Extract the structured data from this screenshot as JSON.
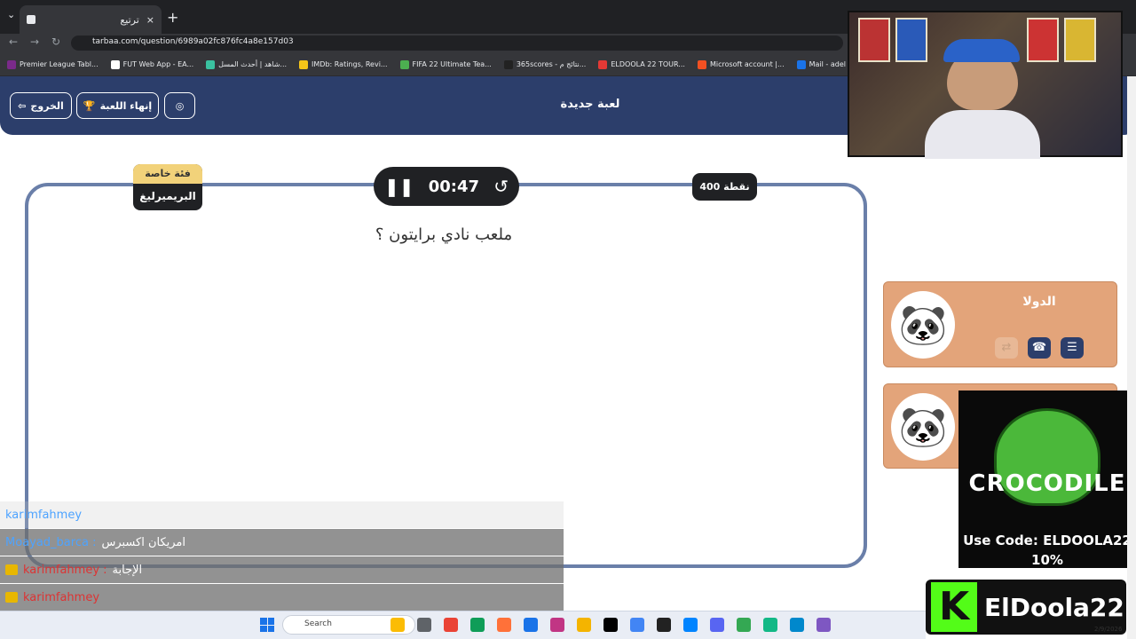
{
  "browser": {
    "tab_title": "ترتيع",
    "new_tab": "+",
    "url": "tarbaa.com/question/6989a02fc876fc4a8e157d03",
    "bookmarks": [
      {
        "label": "Premier League Tabl...",
        "color": "#7a2a8a"
      },
      {
        "label": "FUT Web App - EA...",
        "color": "#ffffff"
      },
      {
        "label": "شاهد | أحدث المسل...",
        "color": "#3ac1a0"
      },
      {
        "label": "IMDb: Ratings, Revi...",
        "color": "#f5c518"
      },
      {
        "label": "FIFA 22 Ultimate Tea...",
        "color": "#4caf50"
      },
      {
        "label": "365scores - نتائج م...",
        "color": "#222222"
      },
      {
        "label": "ELDOOLA 22 TOUR...",
        "color": "#e53935"
      },
      {
        "label": "Microsoft account |...",
        "color": "#f25022"
      },
      {
        "label": "Mail - adel Khamis -...",
        "color": "#1a73e8"
      }
    ]
  },
  "header": {
    "title": "لعبة جديدة",
    "exit_label": "الخروج",
    "end_game_label": "إنهاء اللعبة",
    "settings_icon": "palette-icon"
  },
  "question": {
    "category_label": "فئة خاصة",
    "category_name": "البريميرليغ",
    "timer": "00:47",
    "points": "400 نقطة",
    "text": "ملعب نادي برايتون ؟"
  },
  "teams": [
    {
      "name": "الدولا"
    },
    {
      "name": ""
    }
  ],
  "chat": [
    {
      "user": "karimfahmey",
      "msg": "",
      "faded": true
    },
    {
      "user": "Moayad_barca",
      "msg": "امريكان اكسبرس",
      "faded": false
    },
    {
      "user": "karimfahmey",
      "msg": "الإجابة",
      "faded": false
    },
    {
      "user": "karimfahmey",
      "msg": "",
      "faded": false
    },
    {
      "user": "karimfahmey",
      "msg": "",
      "faded": false
    }
  ],
  "sponsor": {
    "logo_text": "CROCODILE",
    "code_text": "Use Code: ELDOOLA22",
    "discount": "10%"
  },
  "brand": {
    "letter": "K",
    "name": "ElDoola22"
  },
  "taskbar": {
    "search_label": "Search",
    "date": "2/9/2026",
    "icons": [
      "#fbbc04",
      "#5f6368",
      "#ea4335",
      "#0f9d58",
      "#ff7139",
      "#1a73e8",
      "#c13584",
      "#f4b400",
      "#000000",
      "#4285f4",
      "#222222",
      "#0084ff",
      "#5865f2",
      "#34a853",
      "#12b886",
      "#0088cc",
      "#7e57c2"
    ]
  },
  "colors": {
    "header_bg": "#2c3e6b",
    "team_card": "#e3a47a",
    "timer_bg": "#202124",
    "category_tag": "#f2d27a"
  }
}
